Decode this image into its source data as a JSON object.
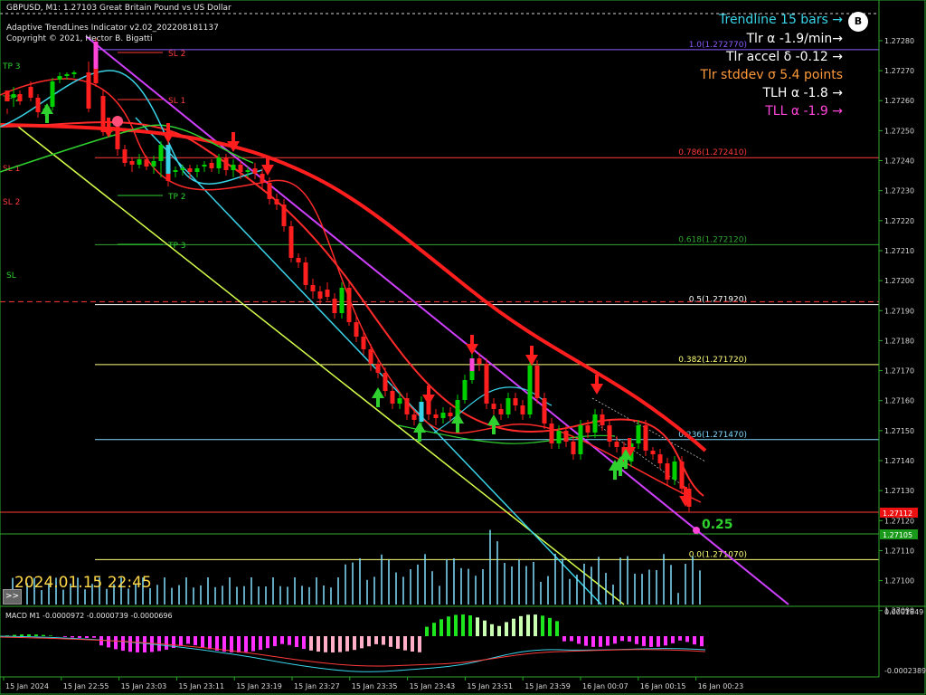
{
  "header": {
    "line1": "GBPUSD, M1: 1.27103  Great Britain Pound vs US Dollar",
    "line2": "Adaptive TrendLines Indicator v2.02_202208181137",
    "line3": "Copyright © 2021, Hector B. Bigatti"
  },
  "info_panel": {
    "trendline": "Trendline 15 bars →",
    "tlr_alpha": "Tlr α -1.9/min→",
    "tlr_accel": "Tlr accel δ -0.12 →",
    "tlr_stddev": "Tlr stddev σ 5.4 points",
    "tlh_alpha": "TLH α -1.8 →",
    "tll_alpha": "TLL α -1.9 →",
    "badge": "B",
    "colors": {
      "trendline": "#39d3e8",
      "tlr_alpha": "#ffffff",
      "tlr_accel": "#ffffff",
      "tlr_stddev": "#ff9a3c",
      "tlh_alpha": "#ffffff",
      "tll_alpha": "#ff44d8"
    }
  },
  "fib_levels": [
    {
      "label": "1.0(1.272770)",
      "price": 1.27277,
      "color": "#8a5cff"
    },
    {
      "label": "0.786(1.272410)",
      "price": 1.27241,
      "color": "#ff3a3a"
    },
    {
      "label": "0.618(1.272120)",
      "price": 1.27212,
      "color": "#2fa82f"
    },
    {
      "label": "0.5(1.271920)",
      "price": 1.27192,
      "color": "#ffffff"
    },
    {
      "label": "0.382(1.271720)",
      "price": 1.27172,
      "color": "#ffff7a"
    },
    {
      "label": "0.236(1.271470)",
      "price": 1.27147,
      "color": "#7fd9ff"
    },
    {
      "label": "0.0(1.271070)",
      "price": 1.27107,
      "color": "#ffff7a"
    }
  ],
  "trade_labels": [
    {
      "text": "SL 2",
      "color": "#ff3a3a"
    },
    {
      "text": "SL 1",
      "color": "#ff3a3a"
    },
    {
      "text": "TP 2",
      "color": "#2fd12f"
    },
    {
      "text": "TP 3",
      "color": "#2fd12f"
    },
    {
      "text": "TP 3",
      "color": "#2fd12f"
    },
    {
      "text": "TP 2",
      "color": "#2fd12f"
    },
    {
      "text": "SL 1",
      "color": "#ff3a3a"
    },
    {
      "text": "SL 2",
      "color": "#ff3a3a"
    },
    {
      "text": "SL",
      "color": "#2fd12f"
    }
  ],
  "price_axis": {
    "labels": [
      "1.27280",
      "1.27270",
      "1.27260",
      "1.27250",
      "1.27240",
      "1.27230",
      "1.27220",
      "1.27210",
      "1.27200",
      "1.27190",
      "1.27180",
      "1.27170",
      "1.27160",
      "1.27150",
      "1.27140",
      "1.27130",
      "1.27120",
      "1.27110",
      "1.27100",
      "1.27090"
    ],
    "current_bid": "1.27112",
    "current_ask": "1.27105"
  },
  "time_axis": [
    "15 Jan 2024",
    "15 Jan 22:55",
    "15 Jan 23:03",
    "15 Jan 23:11",
    "15 Jan 23:19",
    "15 Jan 23:27",
    "15 Jan 23:35",
    "15 Jan 23:43",
    "15 Jan 23:51",
    "15 Jan 23:59",
    "16 Jan 00:07",
    "16 Jan 00:15",
    "16 Jan 00:23"
  ],
  "timestamp": "2024.01.15 22:45",
  "scroll_button": ">>",
  "spread_label": "0.25",
  "macd": {
    "label": "MACD M1 -0.0000972 -0.0000739 -0.0000696",
    "axis_top": "0.0001849",
    "axis_bottom": "-0.0002389"
  },
  "colors": {
    "background": "#000000",
    "bull": "#00d000",
    "bear": "#ff1e1e",
    "axis": "#2fa82f",
    "trend_magenta": "#d040ff",
    "trend_cyan": "#39d3e8",
    "trend_yellow": "#d6ff4a"
  }
}
